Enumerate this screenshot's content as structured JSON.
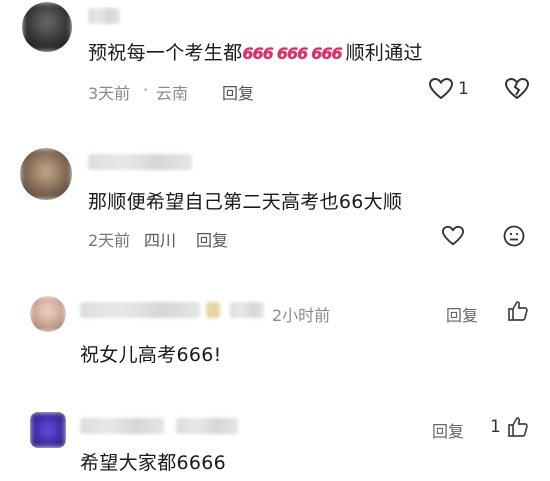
{
  "comments": [
    {
      "text_before": "预祝每一个考生都",
      "emoji": [
        "666",
        "666",
        "666"
      ],
      "text_after": "顺利通过",
      "time": "3天前",
      "separator": "·",
      "location": "云南",
      "reply_label": "回复",
      "like_count": "1"
    },
    {
      "text": "那顺便希望自己第二天高考也66大顺",
      "time": "2天前",
      "location": "四川",
      "reply_label": "回复"
    },
    {
      "text": "祝女儿高考666!",
      "time": "2小时前",
      "reply_label": "回复"
    },
    {
      "text": "希望大家都6666",
      "reply_label": "回复",
      "like_count": "1"
    }
  ],
  "colors": {
    "emoji_666": "#d6336c",
    "meta_text": "#8c8c8c",
    "divider": "#f3f3f3"
  },
  "icons": [
    "heart-outline-icon",
    "heart-broken-icon",
    "emoji-sad-icon",
    "thumbs-up-icon"
  ]
}
